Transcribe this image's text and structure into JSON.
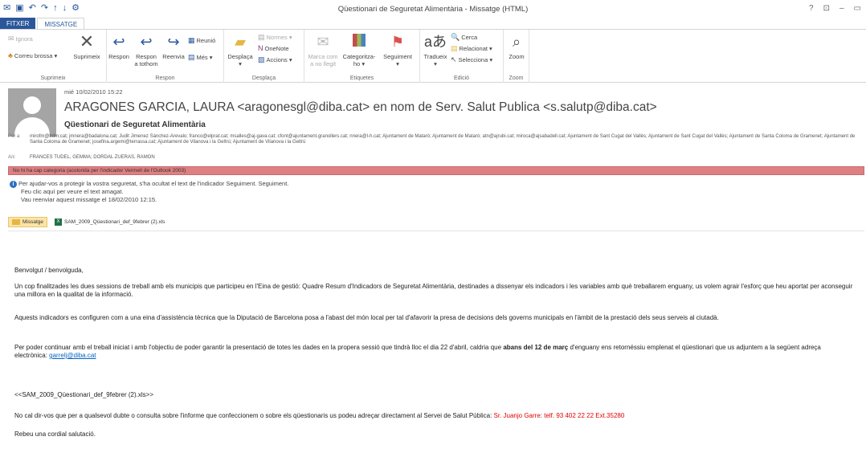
{
  "window": {
    "title": "Qüestionari de Seguretat Alimentària - Missatge (HTML)",
    "controls": [
      "?",
      "⊡",
      "–",
      "▭"
    ]
  },
  "qat_icons": [
    "mail-icon",
    "save-icon",
    "undo-icon",
    "redo-icon",
    "up-icon",
    "down-icon",
    "customize-icon"
  ],
  "tabs": [
    "FITXER",
    "MISSATGE"
  ],
  "ribbon": {
    "suprimeix": {
      "label": "Suprimeix",
      "ignora": "Ignora",
      "correu_brossa": "Correu brossa",
      "suprimeix_btn": "Suprimeix"
    },
    "respon": {
      "label": "Respon",
      "respon": "Respon",
      "respon_tothom_1": "Respon",
      "respon_tothom_2": "a tothom",
      "reenvia": "Reenvia",
      "reunio": "Reunió",
      "mes": "Més"
    },
    "desplaca": {
      "label": "Desplaça",
      "desplaca": "Desplaça",
      "normes": "Normes",
      "onenote": "OneNote",
      "accions": "Accions"
    },
    "etiquetes": {
      "label": "Etiquetes",
      "marca_1": "Marca com",
      "marca_2": "a no llegit",
      "categoritza_1": "Categoritza-",
      "categoritza_2": "ho",
      "seguiment": "Seguiment"
    },
    "edicio": {
      "label": "Edició",
      "tradueix": "Tradueix",
      "cerca": "Cerca",
      "relacionat": "Relacionat",
      "selecciona": "Selecciona"
    },
    "zoom": {
      "label": "Zoom",
      "zoom": "Zoom"
    }
  },
  "message": {
    "date": "mié 10/02/2010 15:22",
    "from": "ARAGONES GARCIA, LAURA <aragonesgl@diba.cat> en nom de Serv. Salut Publica <s.salutp@diba.cat>",
    "subject": "Qüestionari de Seguretat Alimentària",
    "to_label": "Per a",
    "to": "mirofm@bdm.cat; jmnera@badalona.cat; Judit Jimenez Sánchez-Arevalo; franco@elprat.cat; msalles@aj-gava.cat; cfont@ajuntament.granollers.cat; nnera@l-h.cat; Ajuntament de Mataró; Ajuntament de Mataró; atn@ajrubi.cat; miroca@ajsabadell.cat; Ajuntament de Sant Cugat del Vallès; Ajuntament de Sant Cugat del Vallès; Ajuntament de Santa Coloma de Gramenet; Ajuntament de Santa Coloma de Gramenet; josefina.argemi@terrassa.cat; Ajuntament de Vilanova i la Geltrú; Ajuntament de Vilanova i la Geltrú",
    "cc_label": "A/c",
    "cc": "FRANCES TUDEL, GEMMA; DORDAL ZUERAS, RAMON",
    "infobar": "No hi ha cap categoria (acolorida per l'indicador Vermell de l'Outlook 2003)",
    "notice_1": "Per ajudar-vos a protegir la vostra seguretat, s'ha ocultat el text de l'indicador Seguiment. Seguiment.",
    "notice_2": "Feu clic aquí per veure el text amagat.",
    "notice_3": "Vau reenviar aquest missatge el 18/02/2010 12:15.",
    "attachments": [
      "Missatge",
      "SAM_2009_Qüestionari_def_9febrer (2).xls"
    ]
  },
  "body": {
    "greeting": "Benvolgut / benvolguda,",
    "p1": "Un cop finalitzades les dues sessions de treball amb els municipis que participeu en l'Eina de gestió: Quadre Resum d'Indicadors de Seguretat Alimentària, destinades a dissenyar els indicadors i les variables amb què treballarem enguany, us volem agrair l'esforç que heu aportat per aconseguir una millora en la qualitat de la informació.",
    "p2": "Aquests indicadors es configuren com a una eina d'assistència tècnica que la Diputació de Barcelona posa a l'abast del món local per tal d'afavorir la presa de decisions dels governs municipals en l'àmbit de la prestació dels seus serveis al ciutadà.",
    "p3_a": "Per poder continuar amb el treball iniciat i amb l'objectiu de poder garantir la presentació de totes les dades en la propera sessió que tindrà lloc el dia 22 d'abril, caldria que ",
    "p3_bold": "abans del 12 de març",
    "p3_b": " d'enguany ens retornéssiu emplenat el qüestionari que us adjuntem a la següent adreça electrònica: ",
    "p3_link": "garrelj@diba.cat",
    "attachment_ref": "<<SAM_2009_Qüestionari_def_9febrer (2).xls>>",
    "p4_a": "No cal dir-vos que per a qualsevol dubte o consulta sobre l'informe que confeccionem o sobre els qüestionaris us podeu adreçar directament al Servei de Salut Pública: ",
    "p4_red": "Sr. Juanjo Garre: telf. 93 402 22 22  Ext.35280",
    "closing": "Rebeu una cordial salutació."
  }
}
